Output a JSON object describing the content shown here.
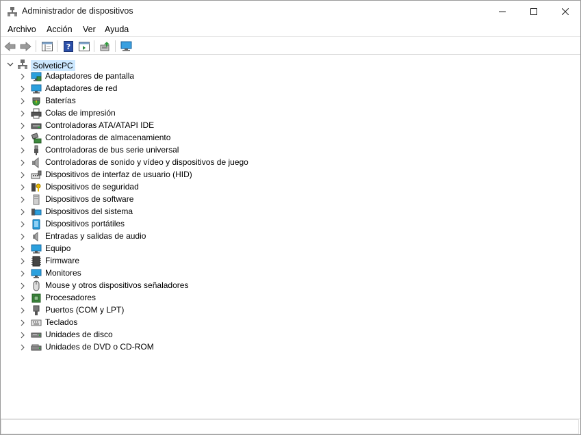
{
  "window": {
    "title": "Administrador de dispositivos"
  },
  "menu": [
    {
      "label": "Archivo"
    },
    {
      "label": "Acción"
    },
    {
      "label": "Ver"
    },
    {
      "label": "Ayuda"
    }
  ],
  "tree": {
    "root": "SolveticPC",
    "items": [
      {
        "label": "Adaptadores de pantalla",
        "icon": "display-adapter-icon"
      },
      {
        "label": "Adaptadores de red",
        "icon": "network-adapter-icon"
      },
      {
        "label": "Baterías",
        "icon": "battery-icon"
      },
      {
        "label": "Colas de impresión",
        "icon": "printer-icon"
      },
      {
        "label": "Controladoras ATA/ATAPI IDE",
        "icon": "ide-controller-icon"
      },
      {
        "label": "Controladoras de almacenamiento",
        "icon": "storage-controller-icon"
      },
      {
        "label": "Controladoras de bus serie universal",
        "icon": "usb-icon"
      },
      {
        "label": "Controladoras de sonido y vídeo y dispositivos de juego",
        "icon": "speaker-icon"
      },
      {
        "label": "Dispositivos de interfaz de usuario (HID)",
        "icon": "hid-icon"
      },
      {
        "label": "Dispositivos de seguridad",
        "icon": "security-key-icon"
      },
      {
        "label": "Dispositivos de software",
        "icon": "software-device-icon"
      },
      {
        "label": "Dispositivos del sistema",
        "icon": "system-device-icon"
      },
      {
        "label": "Dispositivos portátiles",
        "icon": "portable-device-icon"
      },
      {
        "label": "Entradas y salidas de audio",
        "icon": "audio-io-icon"
      },
      {
        "label": "Equipo",
        "icon": "computer-icon"
      },
      {
        "label": "Firmware",
        "icon": "firmware-chip-icon"
      },
      {
        "label": "Monitores",
        "icon": "monitor-icon"
      },
      {
        "label": "Mouse y otros dispositivos señaladores",
        "icon": "mouse-icon"
      },
      {
        "label": "Procesadores",
        "icon": "processor-icon"
      },
      {
        "label": "Puertos (COM y LPT)",
        "icon": "port-icon"
      },
      {
        "label": "Teclados",
        "icon": "keyboard-icon"
      },
      {
        "label": "Unidades de disco",
        "icon": "disk-drive-icon"
      },
      {
        "label": "Unidades de DVD o CD-ROM",
        "icon": "dvd-drive-icon"
      }
    ]
  },
  "colors": {
    "selection": "#cce8ff",
    "accent": "#1a78c2"
  }
}
